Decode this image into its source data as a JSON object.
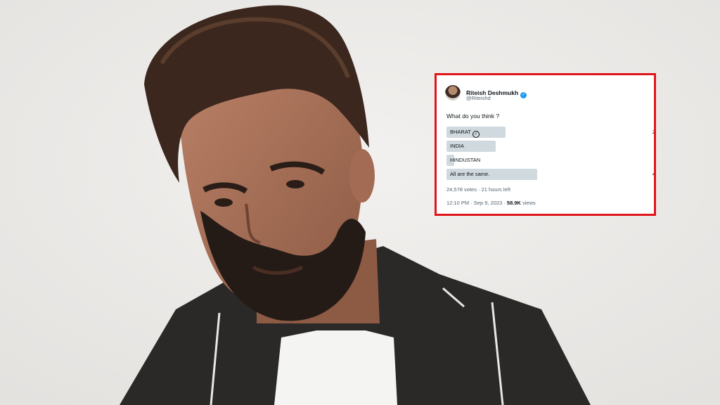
{
  "tweet": {
    "display_name": "Riteish Deshmukh",
    "handle": "@Riteishd",
    "question": "What do you think ?",
    "poll_options": [
      {
        "label": "BHARAT",
        "selected": true,
        "share": 0.3,
        "percent_text": "2"
      },
      {
        "label": "INDIA",
        "selected": false,
        "share": 0.25,
        "percent_text": ""
      },
      {
        "label": "HINDUSTAN",
        "selected": false,
        "share": 0.04,
        "percent_text": ""
      },
      {
        "label": "All are the same.",
        "selected": false,
        "share": 0.46,
        "percent_text": "4"
      }
    ],
    "votes": "24,578 votes",
    "time_left": "21 hours left",
    "time": "12:10 PM",
    "date": "Sep 9, 2023",
    "views_count": "58.9K",
    "views_label": "views"
  },
  "colors": {
    "frame": "#e0141b",
    "poll_bar": "#cfd9de",
    "verified": "#1d9bf0",
    "background": "#ecebe9"
  }
}
